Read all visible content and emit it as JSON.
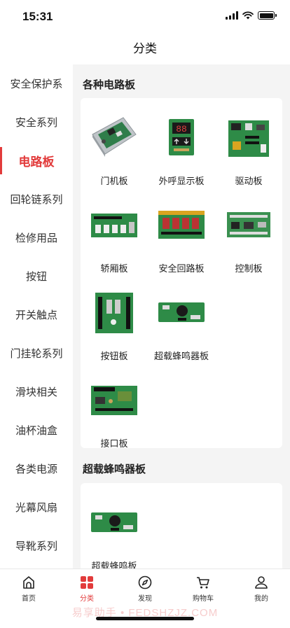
{
  "status": {
    "time": "15:31"
  },
  "nav": {
    "title": "分类"
  },
  "sidebar": {
    "items": [
      {
        "label": "安全保护系"
      },
      {
        "label": "安全系列"
      },
      {
        "label": "电路板",
        "active": true
      },
      {
        "label": "回轮链系列"
      },
      {
        "label": "检修用品"
      },
      {
        "label": "按钮"
      },
      {
        "label": "开关触点"
      },
      {
        "label": "门挂轮系列"
      },
      {
        "label": "滑块相关"
      },
      {
        "label": "油杯油盒"
      },
      {
        "label": "各类电源"
      },
      {
        "label": "光幕风扇"
      },
      {
        "label": "导靴系列"
      }
    ]
  },
  "sections": [
    {
      "title": "各种电路板",
      "products": [
        {
          "label": "门机板",
          "icon": "door-board-image"
        },
        {
          "label": "外呼显示板",
          "icon": "display-board-image"
        },
        {
          "label": "驱动板",
          "icon": "drive-board-image"
        },
        {
          "label": "轿厢板",
          "icon": "car-board-image"
        },
        {
          "label": "安全回路板",
          "icon": "safety-loop-board-image"
        },
        {
          "label": "控制板",
          "icon": "control-board-image"
        },
        {
          "label": "按钮板",
          "icon": "button-board-image"
        },
        {
          "label": "超载蜂鸣器板",
          "icon": "buzzer-board-image"
        },
        {
          "label": "接口板",
          "icon": "interface-board-image"
        }
      ]
    },
    {
      "title": "超载蜂鸣器板",
      "products": [
        {
          "label": "超载蜂鸣板",
          "icon": "buzzer-board-image"
        }
      ]
    }
  ],
  "tabbar": {
    "items": [
      {
        "label": "首页",
        "icon": "home-icon"
      },
      {
        "label": "分类",
        "icon": "category-icon",
        "active": true
      },
      {
        "label": "发现",
        "icon": "compass-icon"
      },
      {
        "label": "购物车",
        "icon": "cart-icon"
      },
      {
        "label": "我的",
        "icon": "profile-icon"
      }
    ]
  },
  "watermark": "易享助手 • FEDSHZJZ.COM",
  "colors": {
    "accent": "#e23b3b",
    "board_green": "#2e8b47",
    "background": "#f4f4f4"
  }
}
